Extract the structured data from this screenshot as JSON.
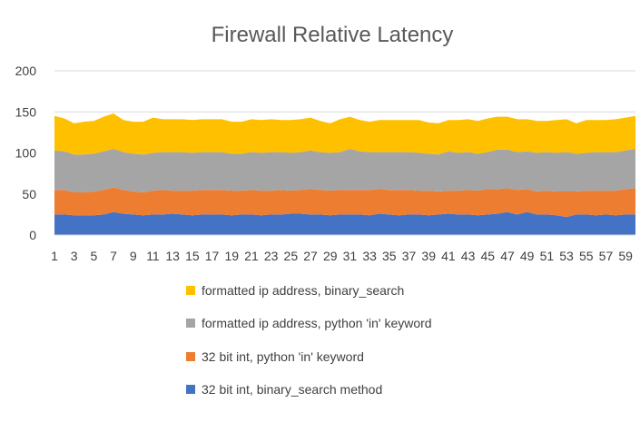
{
  "chart_data": {
    "type": "area",
    "stacked": true,
    "title": "Firewall Relative Latency",
    "xlabel": "",
    "ylabel": "",
    "ylim": [
      0,
      200
    ],
    "yticks": [
      0,
      50,
      100,
      150,
      200
    ],
    "xticks_shown": [
      "1",
      "3",
      "5",
      "7",
      "9",
      "11",
      "13",
      "15",
      "17",
      "19",
      "21",
      "23",
      "25",
      "27",
      "29",
      "31",
      "33",
      "35",
      "37",
      "39",
      "41",
      "43",
      "45",
      "47",
      "49",
      "51",
      "53",
      "55",
      "57",
      "59"
    ],
    "grid": "horizontal",
    "legend_position": "bottom",
    "x": [
      1,
      2,
      3,
      4,
      5,
      6,
      7,
      8,
      9,
      10,
      11,
      12,
      13,
      14,
      15,
      16,
      17,
      18,
      19,
      20,
      21,
      22,
      23,
      24,
      25,
      26,
      27,
      28,
      29,
      30,
      31,
      32,
      33,
      34,
      35,
      36,
      37,
      38,
      39,
      40,
      41,
      42,
      43,
      44,
      45,
      46,
      47,
      48,
      49,
      50,
      51,
      52,
      53,
      54,
      55,
      56,
      57,
      58,
      59,
      60
    ],
    "series": [
      {
        "name": "32 bit int, binary_search method",
        "color": "#4472C4",
        "values": [
          25,
          25,
          24,
          24,
          24,
          25,
          28,
          26,
          25,
          24,
          25,
          25,
          26,
          25,
          24,
          25,
          25,
          25,
          24,
          25,
          25,
          24,
          25,
          25,
          26,
          26,
          25,
          25,
          24,
          25,
          25,
          25,
          24,
          26,
          25,
          24,
          25,
          25,
          24,
          25,
          26,
          25,
          25,
          24,
          25,
          26,
          28,
          25,
          28,
          25,
          25,
          24,
          22,
          25,
          25,
          24,
          25,
          24,
          25,
          25
        ]
      },
      {
        "name": "32 bit int, python 'in' keyword",
        "color": "#ED7D31",
        "values": [
          30,
          30,
          28,
          28,
          29,
          30,
          30,
          29,
          28,
          28,
          29,
          30,
          28,
          29,
          30,
          30,
          30,
          30,
          30,
          29,
          30,
          30,
          29,
          30,
          28,
          29,
          31,
          30,
          30,
          30,
          30,
          30,
          31,
          30,
          30,
          31,
          30,
          29,
          30,
          28,
          28,
          29,
          30,
          30,
          31,
          30,
          29,
          30,
          28,
          28,
          29,
          29,
          31,
          28,
          29,
          30,
          29,
          30,
          31,
          32
        ]
      },
      {
        "name": "formatted ip address, python 'in' keyword",
        "color": "#A5A5A5",
        "values": [
          48,
          47,
          46,
          46,
          46,
          47,
          47,
          46,
          46,
          46,
          46,
          46,
          47,
          47,
          46,
          46,
          46,
          46,
          45,
          45,
          46,
          46,
          47,
          46,
          46,
          46,
          47,
          46,
          46,
          46,
          50,
          47,
          46,
          45,
          46,
          46,
          46,
          46,
          45,
          45,
          48,
          46,
          46,
          45,
          45,
          48,
          47,
          46,
          46,
          47,
          47,
          47,
          48,
          46,
          46,
          47,
          47,
          47,
          47,
          48
        ]
      },
      {
        "name": "formatted ip address, binary_search",
        "color": "#FFC000",
        "values": [
          42,
          40,
          38,
          40,
          40,
          42,
          43,
          39,
          39,
          40,
          43,
          40,
          40,
          40,
          40,
          40,
          40,
          40,
          39,
          39,
          40,
          40,
          40,
          39,
          40,
          40,
          40,
          38,
          36,
          40,
          39,
          38,
          37,
          39,
          39,
          39,
          39,
          40,
          38,
          38,
          38,
          40,
          40,
          40,
          41,
          40,
          40,
          40,
          39,
          39,
          38,
          40,
          40,
          37,
          40,
          39,
          39,
          40,
          40,
          40
        ]
      }
    ]
  }
}
